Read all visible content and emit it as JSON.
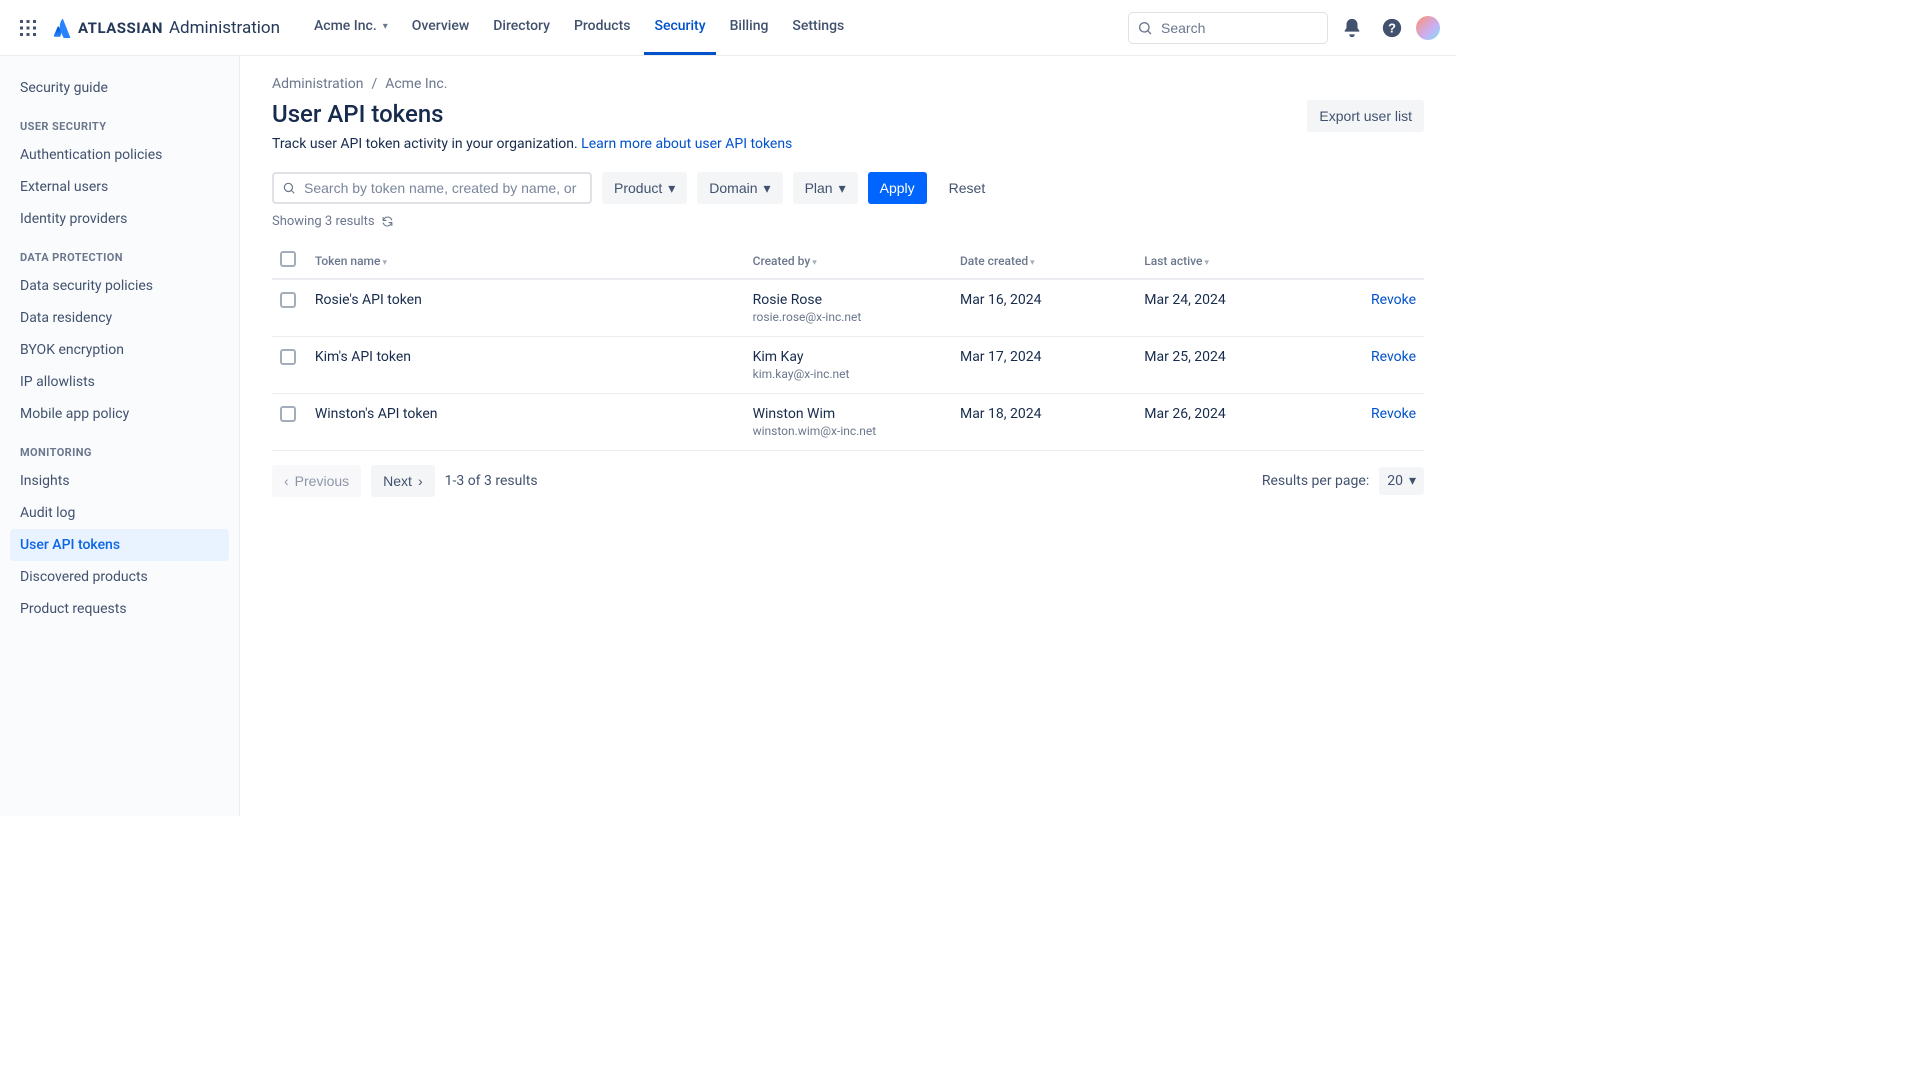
{
  "topnav": {
    "brand_word": "ATLASSIAN",
    "brand_suffix": "Administration",
    "org_switcher": "Acme Inc.",
    "items": [
      "Overview",
      "Directory",
      "Products",
      "Security",
      "Billing",
      "Settings"
    ],
    "active_index": 3,
    "search_placeholder": "Search"
  },
  "sidebar": {
    "top_link": "Security guide",
    "groups": [
      {
        "label": "USER SECURITY",
        "items": [
          "Authentication policies",
          "External users",
          "Identity providers"
        ]
      },
      {
        "label": "DATA PROTECTION",
        "items": [
          "Data security policies",
          "Data residency",
          "BYOK encryption",
          "IP allowlists",
          "Mobile app policy"
        ]
      },
      {
        "label": "MONITORING",
        "items": [
          "Insights",
          "Audit log",
          "User API tokens",
          "Discovered products",
          "Product requests"
        ]
      }
    ],
    "selected": "User API tokens"
  },
  "breadcrumbs": {
    "root": "Administration",
    "org": "Acme Inc."
  },
  "page": {
    "title": "User API tokens",
    "export_label": "Export user list",
    "description_prefix": "Track user API token activity in your organization. ",
    "description_link": "Learn more about user API tokens"
  },
  "filters": {
    "search_placeholder": "Search by token name, created by name, or email",
    "product": "Product",
    "domain": "Domain",
    "plan": "Plan",
    "apply": "Apply",
    "reset": "Reset",
    "showing": "Showing 3 results"
  },
  "table": {
    "columns": {
      "token": "Token name",
      "created_by": "Created by",
      "date_created": "Date created",
      "last_active": "Last active"
    },
    "revoke": "Revoke",
    "rows": [
      {
        "token": "Rosie's API token",
        "user": "Rosie Rose",
        "email": "rosie.rose@x-inc.net",
        "created": "Mar 16, 2024",
        "active": "Mar 24, 2024"
      },
      {
        "token": "Kim's API token",
        "user": "Kim Kay",
        "email": "kim.kay@x-inc.net",
        "created": "Mar 17, 2024",
        "active": "Mar 25, 2024"
      },
      {
        "token": "Winston's API token",
        "user": "Winston Wim",
        "email": "winston.wim@x-inc.net",
        "created": "Mar 18, 2024",
        "active": "Mar 26, 2024"
      }
    ]
  },
  "pager": {
    "previous": "Previous",
    "next": "Next",
    "range": "1-3 of 3 results",
    "results_per_page_label": "Results per page:",
    "results_per_page_value": "20"
  }
}
